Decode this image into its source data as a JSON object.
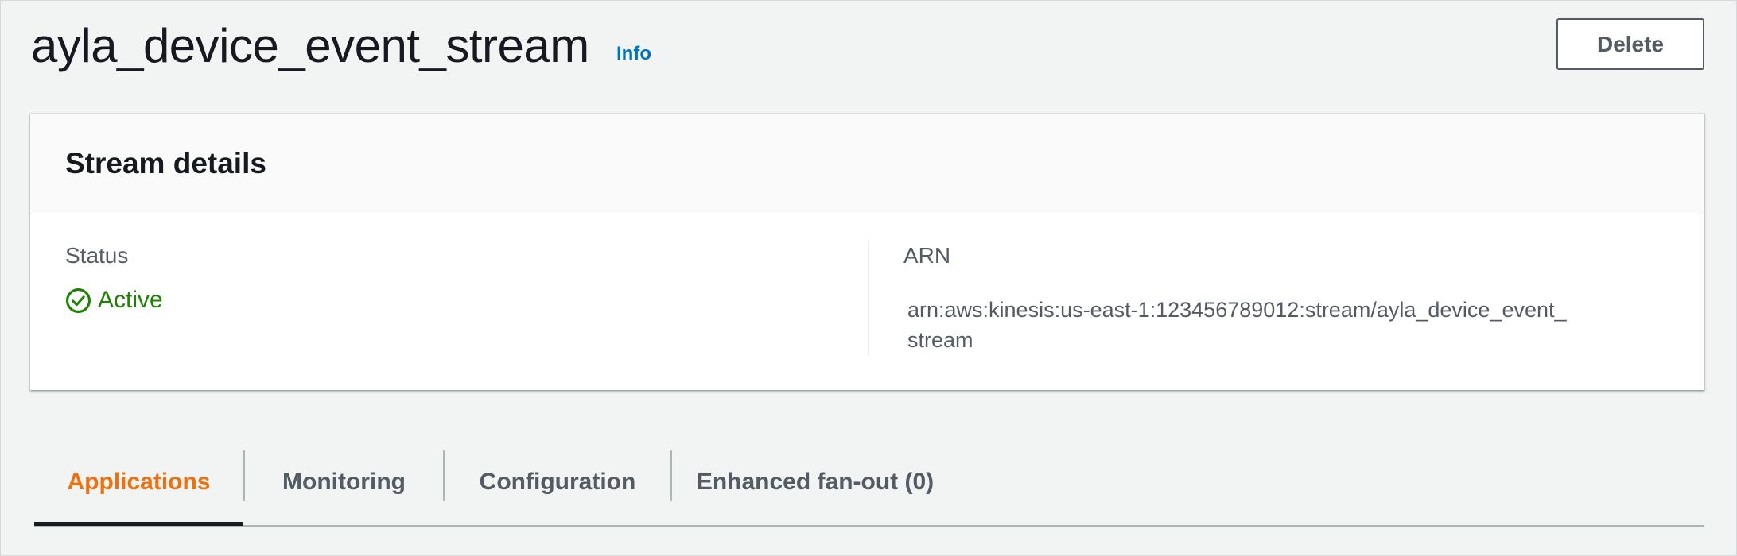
{
  "header": {
    "title": "ayla_device_event_stream",
    "info_label": "Info",
    "delete_label": "Delete"
  },
  "details": {
    "title": "Stream details",
    "status_label": "Status",
    "status_value": "Active",
    "status_icon": "check-circle-icon",
    "arn_label": "ARN",
    "arn_value": "arn:aws:kinesis:us-east-1:123456789012:stream/ayla_device_event_stream"
  },
  "tabs": [
    {
      "label": "Applications",
      "active": true
    },
    {
      "label": "Monitoring",
      "active": false
    },
    {
      "label": "Configuration",
      "active": false
    },
    {
      "label": "Enhanced fan-out (0)",
      "active": false
    }
  ],
  "colors": {
    "accent_active_tab": "#ec7211",
    "status_ok": "#1d8102",
    "link": "#0073bb"
  }
}
